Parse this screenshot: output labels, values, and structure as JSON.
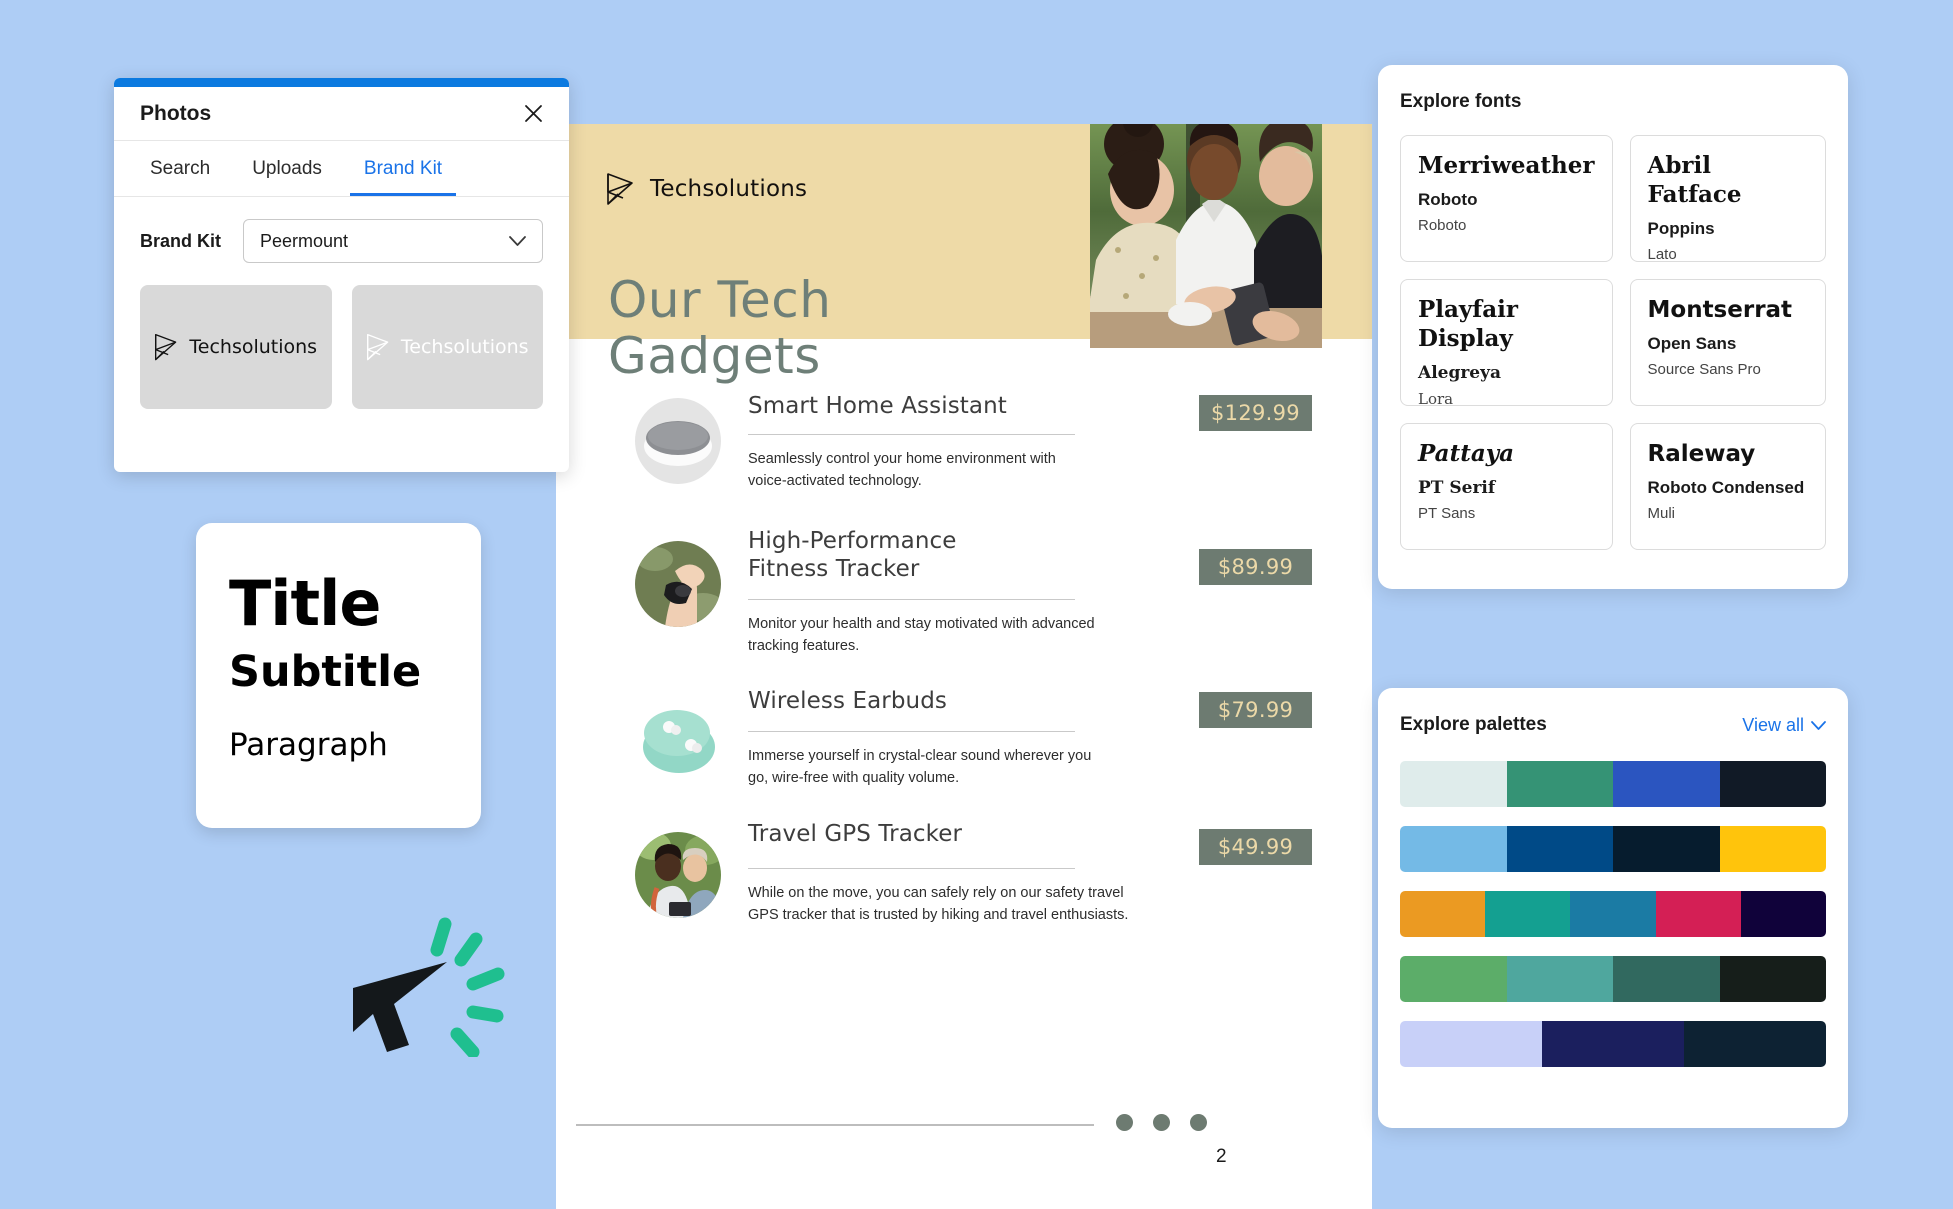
{
  "theme": {
    "background": "#aecdf5",
    "accent_blue": "#1a73e8",
    "panel_accent_bar": "#0b7ae0",
    "banner_tan": "#eedaa7",
    "price_tag_bg": "#6d7b71",
    "price_tag_text": "#ecd9a8",
    "doc_title_color": "#6e7f78"
  },
  "photos_panel": {
    "title": "Photos",
    "close_icon": "close-icon",
    "tabs": [
      {
        "label": "Search",
        "active": false
      },
      {
        "label": "Uploads",
        "active": false
      },
      {
        "label": "Brand Kit",
        "active": true
      }
    ],
    "brand_kit_label": "Brand Kit",
    "brand_kit_select": {
      "value": "Peermount",
      "chevron_icon": "chevron-down-icon"
    },
    "logo_tiles": [
      {
        "label": "Techsolutions",
        "variant": "dark",
        "icon": "techsolutions-logo-icon"
      },
      {
        "label": "Techsolutions",
        "variant": "light",
        "icon": "techsolutions-logo-icon"
      }
    ]
  },
  "type_card": {
    "title": "Title",
    "subtitle": "Subtitle",
    "paragraph": "Paragraph"
  },
  "cursor": {
    "icon": "cursor-click-icon",
    "arrow_color": "#14181b",
    "burst_color": "#1fbf8f"
  },
  "document": {
    "brand_name": "Techsolutions",
    "logo_icon": "techsolutions-logo-icon",
    "title": "Our Tech Gadgets",
    "hero_image_alt": "three-people-looking-at-phone",
    "page_number": "2",
    "carousel_dots": 3,
    "products": [
      {
        "name": "Smart Home Assistant",
        "price": "$129.99",
        "description": "Seamlessly control your home environment with voice-activated technology.",
        "thumb": "smart-speaker-photo"
      },
      {
        "name": "High-Performance Fitness Tracker",
        "price": "$89.99",
        "description": "Monitor your health and stay motivated with advanced tracking features.",
        "thumb": "wrist-fitness-tracker-photo"
      },
      {
        "name": "Wireless Earbuds",
        "price": "$79.99",
        "description": "Immerse yourself in crystal-clear sound wherever you go, wire-free with quality volume.",
        "thumb": "mint-wireless-earbuds-photo"
      },
      {
        "name": "Travel GPS Tracker",
        "price": "$49.99",
        "description": "While on the move, you can safely rely on our safety travel GPS tracker that is trusted by hiking and travel enthusiasts.",
        "thumb": "two-travelers-with-phone-photo"
      }
    ]
  },
  "fonts_panel": {
    "title": "Explore fonts",
    "cards": [
      {
        "primary": "Merriweather",
        "primary_style": "serif",
        "secondary": "Roboto",
        "secondary_style": "sans",
        "tertiary": "Roboto",
        "tertiary_style": "sans"
      },
      {
        "primary": "Abril Fatface",
        "primary_style": "serif",
        "secondary": "Poppins",
        "secondary_style": "sans",
        "tertiary": "Lato",
        "tertiary_style": "sans"
      },
      {
        "primary": "Playfair Display",
        "primary_style": "serif",
        "secondary": "Alegreya",
        "secondary_style": "serif",
        "tertiary": "Lora",
        "tertiary_style": "serif"
      },
      {
        "primary": "Montserrat",
        "primary_style": "sans",
        "secondary": "Open Sans",
        "secondary_style": "sans",
        "tertiary": "Source Sans Pro",
        "tertiary_style": "sans"
      },
      {
        "primary": "Pattaya",
        "primary_style": "ital",
        "secondary": "PT Serif",
        "secondary_style": "serif",
        "tertiary": "PT Sans",
        "tertiary_style": "sans"
      },
      {
        "primary": "Raleway",
        "primary_style": "sans",
        "secondary": "Roboto Condensed",
        "secondary_style": "sans",
        "tertiary": "Muli",
        "tertiary_style": "sans"
      }
    ]
  },
  "palettes_panel": {
    "title": "Explore palettes",
    "view_all_label": "View all",
    "view_all_icon": "chevron-down-icon",
    "palettes": [
      {
        "colors": [
          "#dfeceb",
          "#359375",
          "#2b55c0",
          "#111a26"
        ],
        "weights": [
          1,
          1,
          1,
          1
        ]
      },
      {
        "colors": [
          "#74bae6",
          "#004a87",
          "#061c2e",
          "#ffc40c"
        ],
        "weights": [
          1,
          1,
          1,
          1
        ]
      },
      {
        "colors": [
          "#eb9a22",
          "#14a091",
          "#1b7ba4",
          "#d41f55",
          "#10023a"
        ],
        "weights": [
          1,
          1,
          1,
          1,
          1
        ]
      },
      {
        "colors": [
          "#5cad69",
          "#4fa79e",
          "#31695f",
          "#161e1a"
        ],
        "weights": [
          1,
          1,
          1,
          1
        ]
      },
      {
        "colors": [
          "#c8d0f8",
          "#1b1f5e",
          "#0d2233"
        ],
        "weights": [
          1.4,
          1.4,
          1.4
        ]
      }
    ]
  }
}
